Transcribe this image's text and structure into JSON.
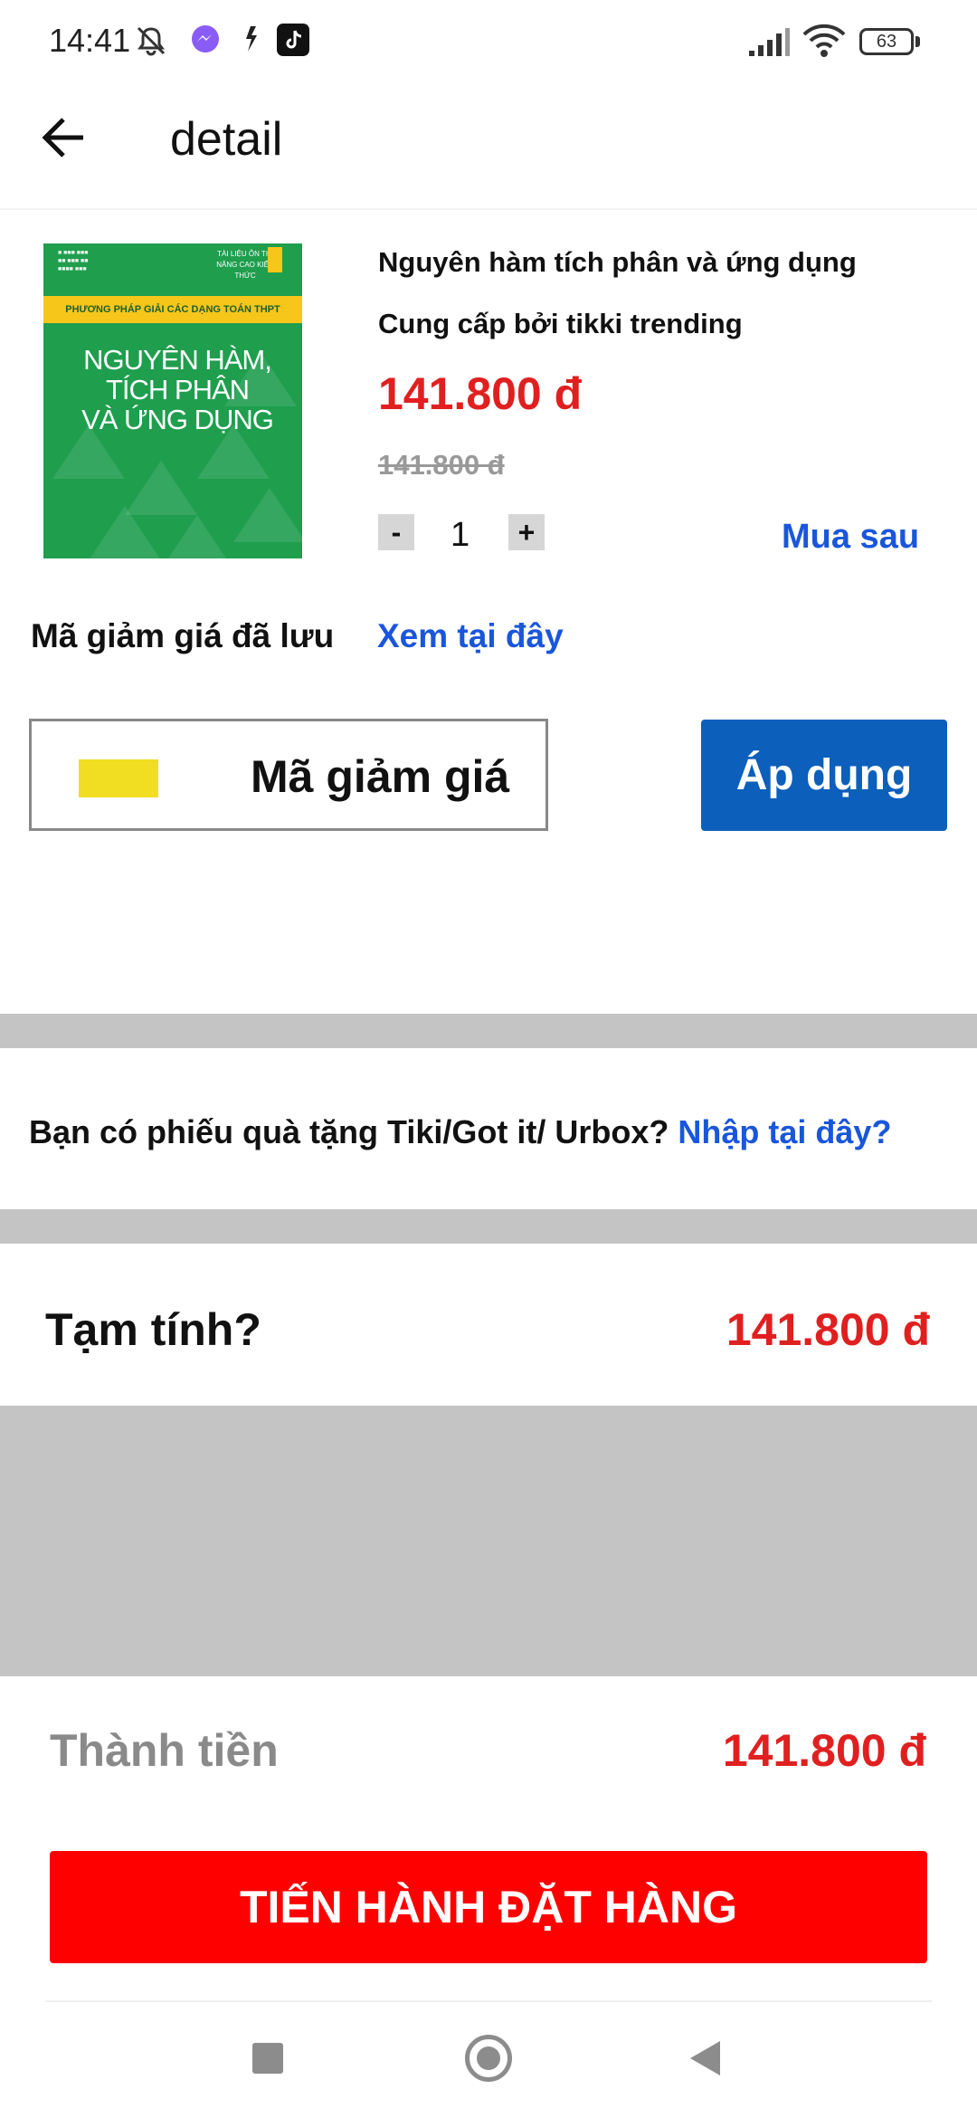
{
  "status_bar": {
    "time": "14:41",
    "battery": "63",
    "icons": [
      "mute-icon",
      "messenger-icon",
      "app-icon",
      "tiktok-icon",
      "signal-icon",
      "wifi-icon",
      "battery-icon"
    ]
  },
  "header": {
    "title": "detail",
    "back_icon": "arrow-left-icon"
  },
  "product": {
    "cover": {
      "band_text": "PHƯƠNG PHÁP GIẢI CÁC DẠNG TOÁN THPT",
      "title_lines": [
        "NGUYÊN HÀM,",
        "TÍCH PHÂN",
        "VÀ ỨNG DỤNG"
      ],
      "tag": "TÀI LIỆU ÔN THI NÂNG CAO KIẾN THỨC"
    },
    "name": "Nguyên hàm tích phân và ứng dụng",
    "seller": "Cung cấp bởi tikki trending",
    "price": "141.800 đ",
    "old_price": "141.800 đ",
    "quantity": {
      "minus": "-",
      "value": "1",
      "plus": "+"
    },
    "buy_later": "Mua sau"
  },
  "coupon": {
    "saved_label": "Mã giảm giá đã lưu",
    "saved_link": "Xem tại đây",
    "input_placeholder": "Mã giảm giá",
    "apply_label": "Áp dụng"
  },
  "gift": {
    "question": "Bạn có phiếu quà tặng Tiki/Got it/ Urbox?",
    "link": "Nhập tại đây?"
  },
  "summary": {
    "subtotal_label": "Tạm tính?",
    "subtotal_value": "141.800 đ",
    "total_label": "Thành tiền",
    "total_value": "141.800 đ",
    "order_button": "TIẾN HÀNH ĐẶT HÀNG"
  },
  "colors": {
    "price_red": "#e02020",
    "link_blue": "#1a56db",
    "apply_blue": "#0c5fbb",
    "order_red": "#fe0000",
    "separator_gray": "#c4c4c4"
  }
}
